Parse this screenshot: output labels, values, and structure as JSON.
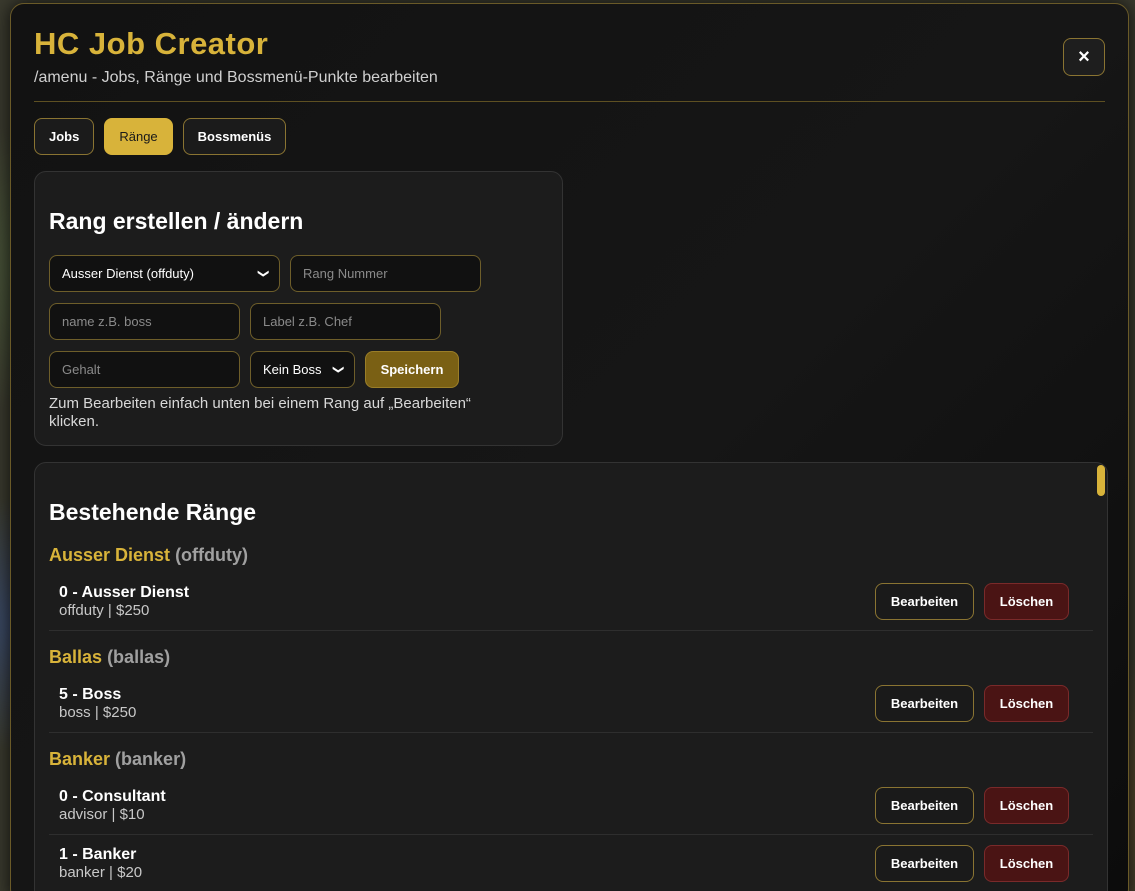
{
  "header": {
    "title": "HC Job Creator",
    "subtitle": "/amenu - Jobs, Ränge und Bossmenü-Punkte bearbeiten",
    "close_icon": "×"
  },
  "tabs": [
    {
      "label": "Jobs",
      "active": false
    },
    {
      "label": "Ränge",
      "active": true
    },
    {
      "label": "Bossmenüs",
      "active": false
    }
  ],
  "form": {
    "title": "Rang erstellen / ändern",
    "job_select_value": "Ausser Dienst (offduty)",
    "rank_number_placeholder": "Rang Nummer",
    "name_placeholder": "name z.B. boss",
    "label_placeholder": "Label z.B. Chef",
    "salary_placeholder": "Gehalt",
    "boss_select_value": "Kein Boss",
    "save_label": "Speichern",
    "hint": "Zum Bearbeiten einfach unten bei einem Rang auf „Bearbeiten“ klicken."
  },
  "list": {
    "title": "Bestehende Ränge",
    "edit_label": "Bearbeiten",
    "delete_label": "Löschen",
    "groups": [
      {
        "label": "Ausser Dienst",
        "code": "(offduty)",
        "ranks": [
          {
            "name": "0 - Ausser Dienst",
            "meta": "offduty | $250"
          }
        ]
      },
      {
        "label": "Ballas",
        "code": "(ballas)",
        "ranks": [
          {
            "name": "5 - Boss",
            "meta": "boss | $250"
          }
        ]
      },
      {
        "label": "Banker",
        "code": "(banker)",
        "ranks": [
          {
            "name": "0 - Consultant",
            "meta": "advisor | $10"
          },
          {
            "name": "1 - Banker",
            "meta": "banker | $20"
          }
        ]
      }
    ]
  },
  "colors": {
    "accent": "#d8b33a",
    "danger": "#4a1414"
  }
}
